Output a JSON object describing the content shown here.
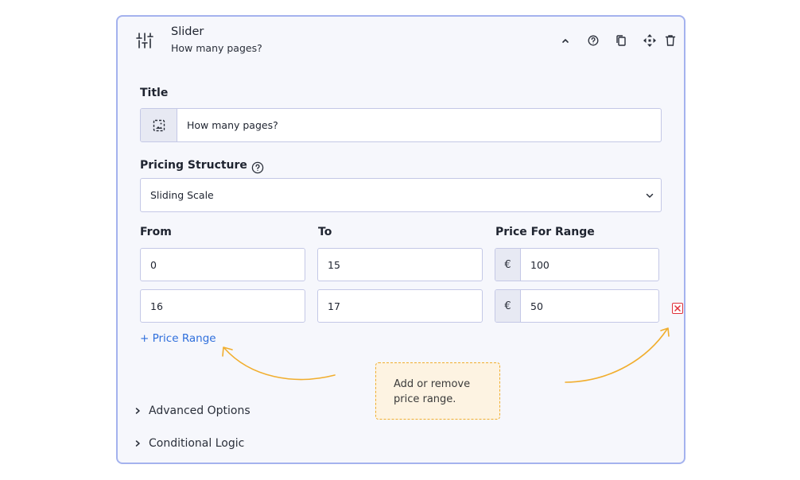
{
  "header": {
    "icon": "sliders-icon",
    "title": "Slider",
    "subtitle": "How many pages?",
    "tools": [
      "chevron-up-icon",
      "help-icon",
      "copy-icon",
      "move-icon",
      "trash-icon"
    ]
  },
  "title_field": {
    "label": "Title",
    "value": "How many pages?",
    "icon": "image-icon"
  },
  "pricing": {
    "label": "Pricing Structure",
    "selected": "Sliding Scale"
  },
  "ranges": {
    "headers": [
      "From",
      "To",
      "Price For Range"
    ],
    "currency": "€",
    "rows": [
      {
        "from": "0",
        "to": "15",
        "price": "100"
      },
      {
        "from": "16",
        "to": "17",
        "price": "50"
      }
    ],
    "add_label": "+ Price Range"
  },
  "sections": [
    "Advanced Options",
    "Conditional Logic"
  ],
  "annotation": {
    "line1": "Add or remove",
    "line2": "price range.",
    "color": "#f1ae2e"
  },
  "colors": {
    "card_border": "#a4b2ee",
    "link": "#2f6fdc",
    "remove": "#e0303a"
  }
}
